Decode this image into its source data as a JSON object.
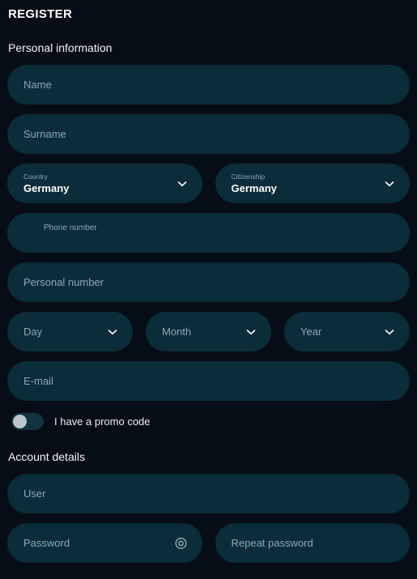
{
  "page": {
    "title": "REGISTER"
  },
  "sections": {
    "personal": {
      "heading": "Personal information",
      "name": {
        "placeholder": "Name"
      },
      "surname": {
        "placeholder": "Surname"
      },
      "country": {
        "label": "Country",
        "value": "Germany",
        "icon": "chevron-down-icon"
      },
      "citizenship": {
        "label": "Citizenship",
        "value": "Germany",
        "icon": "chevron-down-icon"
      },
      "phone": {
        "placeholder": "Phone number"
      },
      "personal_number": {
        "placeholder": "Personal number"
      },
      "day": {
        "placeholder": "Day",
        "icon": "chevron-down-icon"
      },
      "month": {
        "placeholder": "Month",
        "icon": "chevron-down-icon"
      },
      "year": {
        "placeholder": "Year",
        "icon": "chevron-down-icon"
      },
      "email": {
        "placeholder": "E-mail"
      },
      "promo": {
        "label": "I have a promo code",
        "state": "off"
      }
    },
    "account": {
      "heading": "Account details",
      "user": {
        "placeholder": "User"
      },
      "password": {
        "placeholder": "Password",
        "icon": "eye-icon"
      },
      "repeat_password": {
        "placeholder": "Repeat password"
      }
    }
  },
  "colors": {
    "background": "#060d16",
    "field": "#0b2c39",
    "placeholder": "#8ea8b6",
    "text": "#ffffff",
    "toggle_track": "#123340",
    "toggle_knob": "#b9c6cb"
  }
}
